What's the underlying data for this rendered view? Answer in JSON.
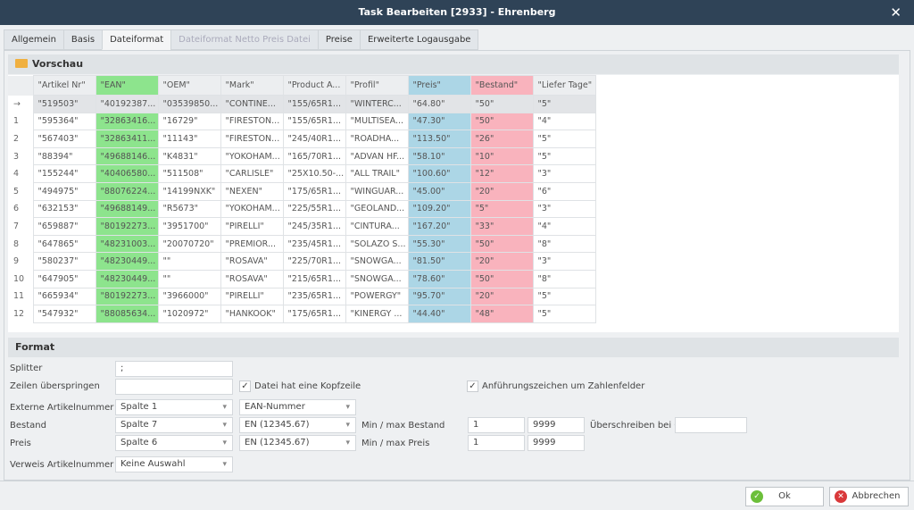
{
  "window": {
    "title": "Task Bearbeiten [2933] - Ehrenberg",
    "close": "✕"
  },
  "tabs": [
    {
      "label": "Allgemein"
    },
    {
      "label": "Basis"
    },
    {
      "label": "Dateiformat"
    },
    {
      "label": "Dateiformat Netto Preis Datei"
    },
    {
      "label": "Preise"
    },
    {
      "label": "Erweiterte Logausgabe"
    }
  ],
  "active_tab": "Dateiformat",
  "preview": {
    "title": "Vorschau",
    "columns": [
      "\"Artikel Nr\"",
      "\"EAN\"",
      "\"OEM\"",
      "\"Mark\"",
      "\"Product A...",
      "\"Profil\"",
      "\"Preis\"",
      "\"Bestand\"",
      "\"Liefer Tage\""
    ],
    "column_colors": {
      "EAN": "#8de48d",
      "Preis": "#acd6e6",
      "Bestand": "#f9b3bd"
    },
    "rows": [
      {
        "ind": "→",
        "cells": [
          "\"519503\"",
          "\"40192387...",
          "\"03539850...",
          "\"CONTINE...",
          "\"155/65R1...",
          "\"WINTERC...",
          "\"64.80\"",
          "\"50\"",
          "\"5\""
        ]
      },
      {
        "ind": "1",
        "cells": [
          "\"595364\"",
          "\"32863416...",
          "\"16729\"",
          "\"FIRESTON...",
          "\"155/65R1...",
          "\"MULTISEA...",
          "\"47.30\"",
          "\"50\"",
          "\"4\""
        ]
      },
      {
        "ind": "2",
        "cells": [
          "\"567403\"",
          "\"32863411...",
          "\"11143\"",
          "\"FIRESTON...",
          "\"245/40R1...",
          "\"ROADHA...",
          "\"113.50\"",
          "\"26\"",
          "\"5\""
        ]
      },
      {
        "ind": "3",
        "cells": [
          "\"88394\"",
          "\"49688146...",
          "\"K4831\"",
          "\"YOKOHAM...",
          "\"165/70R1...",
          "\"ADVAN HF...",
          "\"58.10\"",
          "\"10\"",
          "\"5\""
        ]
      },
      {
        "ind": "4",
        "cells": [
          "\"155244\"",
          "\"40406580...",
          "\"511508\"",
          "\"CARLISLE\"",
          "\"25X10.50-...",
          "\"ALL TRAIL\"",
          "\"100.60\"",
          "\"12\"",
          "\"3\""
        ]
      },
      {
        "ind": "5",
        "cells": [
          "\"494975\"",
          "\"88076224...",
          "\"14199NXK\"",
          "\"NEXEN\"",
          "\"175/65R1...",
          "\"WINGUAR...",
          "\"45.00\"",
          "\"20\"",
          "\"6\""
        ]
      },
      {
        "ind": "6",
        "cells": [
          "\"632153\"",
          "\"49688149...",
          "\"R5673\"",
          "\"YOKOHAM...",
          "\"225/55R1...",
          "\"GEOLAND...",
          "\"109.20\"",
          "\"5\"",
          "\"3\""
        ]
      },
      {
        "ind": "7",
        "cells": [
          "\"659887\"",
          "\"80192273...",
          "\"3951700\"",
          "\"PIRELLI\"",
          "\"245/35R1...",
          "\"CINTURA...",
          "\"167.20\"",
          "\"33\"",
          "\"4\""
        ]
      },
      {
        "ind": "8",
        "cells": [
          "\"647865\"",
          "\"48231003...",
          "\"20070720\"",
          "\"PREMIOR...",
          "\"235/45R1...",
          "\"SOLAZO S...",
          "\"55.30\"",
          "\"50\"",
          "\"8\""
        ]
      },
      {
        "ind": "9",
        "cells": [
          "\"580237\"",
          "\"48230449...",
          "\"\"",
          "\"ROSAVA\"",
          "\"225/70R1...",
          "\"SNOWGA...",
          "\"81.50\"",
          "\"20\"",
          "\"3\""
        ]
      },
      {
        "ind": "10",
        "cells": [
          "\"647905\"",
          "\"48230449...",
          "\"\"",
          "\"ROSAVA\"",
          "\"215/65R1...",
          "\"SNOWGA...",
          "\"78.60\"",
          "\"50\"",
          "\"8\""
        ]
      },
      {
        "ind": "11",
        "cells": [
          "\"665934\"",
          "\"80192273...",
          "\"3966000\"",
          "\"PIRELLI\"",
          "\"235/65R1...",
          "\"POWERGY\"",
          "\"95.70\"",
          "\"20\"",
          "\"5\""
        ]
      },
      {
        "ind": "12",
        "cells": [
          "\"547932\"",
          "\"88085634...",
          "\"1020972\"",
          "\"HANKOOK\"",
          "\"175/65R1...",
          "\"KINERGY ...",
          "\"44.40\"",
          "\"48\"",
          "\"5\""
        ]
      }
    ]
  },
  "format": {
    "title": "Format",
    "splitter_label": "Splitter",
    "splitter_value": ";",
    "skip_label": "Zeilen überspringen",
    "skip_value": "",
    "header_checkbox": "Datei hat eine Kopfzeile",
    "header_checked": true,
    "quotes_checkbox": "Anführungszeichen um Zahlenfelder",
    "quotes_checked": true,
    "ext_label": "Externe Artikelnummer",
    "ext_col": "Spalte 1",
    "ext_type": "EAN-Nummer",
    "stock_label": "Bestand",
    "stock_col": "Spalte 7",
    "stock_fmt": "EN (12345.67)",
    "stock_minmax_label": "Min / max Bestand",
    "stock_min": "1",
    "stock_max": "9999",
    "overwrite_label": "Überschreiben bei 0",
    "overwrite_value": "",
    "price_label": "Preis",
    "price_col": "Spalte 6",
    "price_fmt": "EN (12345.67)",
    "price_minmax_label": "Min / max Preis",
    "price_min": "1",
    "price_max": "9999",
    "ref_label": "Verweis Artikelnummer",
    "ref_value": "Keine Auswahl"
  },
  "buttons": {
    "ok": "Ok",
    "cancel": "Abbrechen"
  }
}
